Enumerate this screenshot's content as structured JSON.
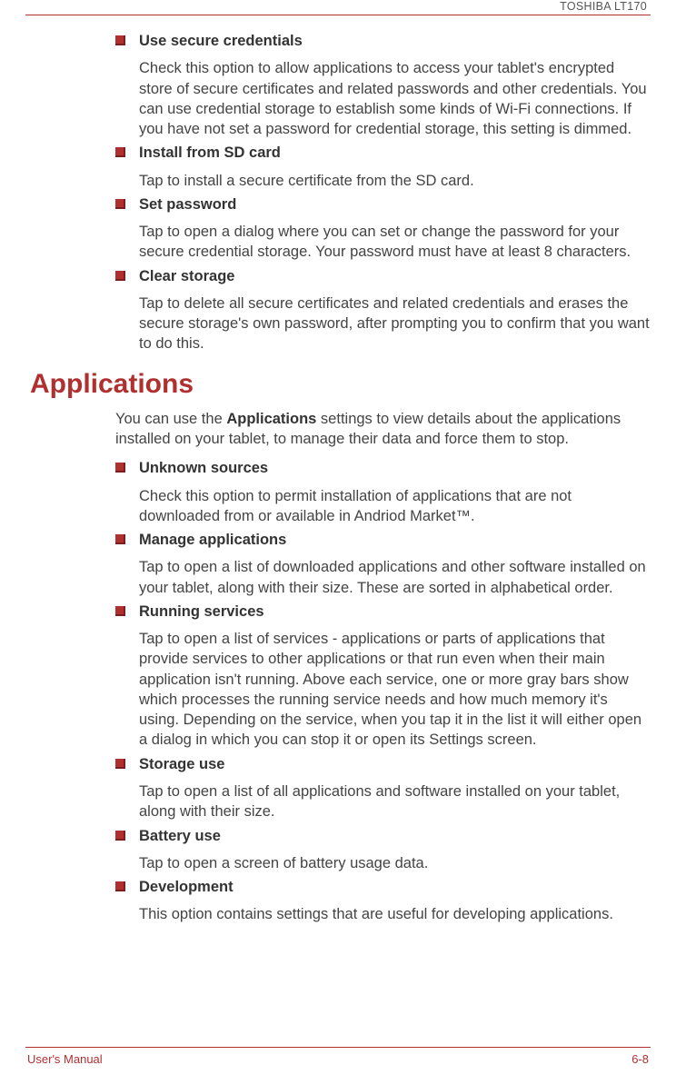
{
  "header": {
    "right": "TOSHIBA LT170"
  },
  "top_items": [
    {
      "title": "Use secure credentials",
      "body": "Check this option to allow applications to access your tablet's encrypted store of secure certificates and related passwords and other credentials. You can use credential storage to establish some kinds of Wi-Fi connections. If you have not set a password for credential storage, this setting is dimmed."
    },
    {
      "title": "Install from SD card",
      "body": "Tap to install a secure certificate from the SD card."
    },
    {
      "title": "Set password",
      "body": "Tap to open a dialog where you can set or change the password for your secure credential storage. Your password must have at least 8 characters."
    },
    {
      "title": "Clear storage",
      "body": "Tap to delete all secure certificates and related credentials and erases the secure storage's own password, after prompting you to confirm that you want to do this."
    }
  ],
  "section": {
    "heading": "Applications",
    "intro_pre": "You can use the ",
    "intro_bold": "Applications",
    "intro_post": " settings to view details about the applications installed on your tablet, to manage their data and force them to stop.",
    "items": [
      {
        "title": "Unknown sources",
        "body": "Check this option to permit installation of applications that are not downloaded from or available in Andriod Market™."
      },
      {
        "title": "Manage applications",
        "body": "Tap to open a list of downloaded applications and other software installed on your tablet, along with their size. These are sorted in alphabetical order."
      },
      {
        "title": "Running services",
        "body": "Tap to open a list of services - applications or parts of applications that provide services to other applications or that run even when their main application isn't running. Above each service, one or more gray bars show which processes the running service needs and how much memory it's using. Depending on the service, when you tap it in the list it will either open a dialog in which you can stop it or open its Settings screen."
      },
      {
        "title": "Storage use",
        "body": "Tap to open a list of all applications and software installed on your tablet, along with their size."
      },
      {
        "title": "Battery use",
        "body": "Tap to open a screen of battery usage data."
      },
      {
        "title": "Development",
        "body": "This option contains settings that are useful for developing applications."
      }
    ]
  },
  "footer": {
    "left": "User's Manual",
    "right": "6-8"
  }
}
